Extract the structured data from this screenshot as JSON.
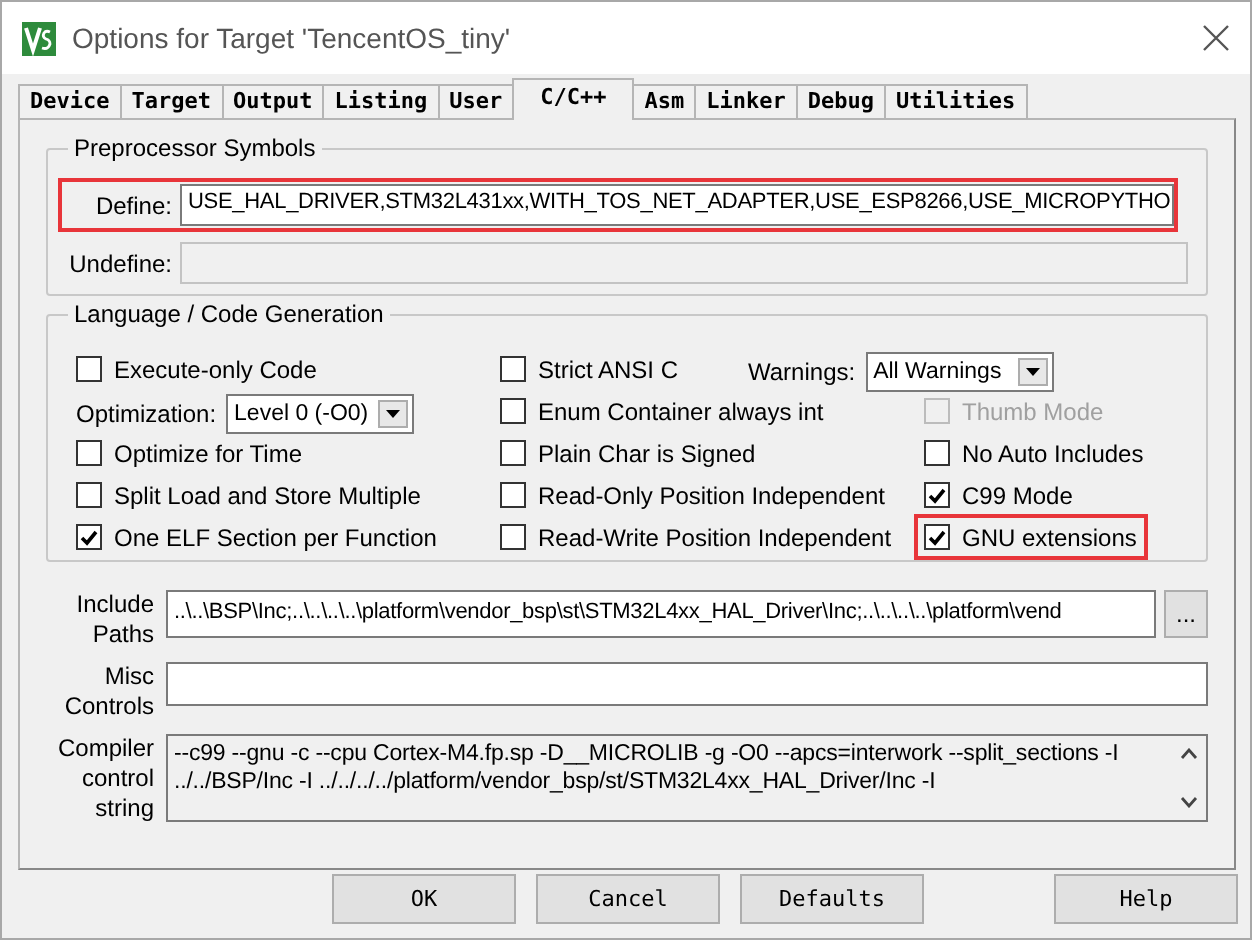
{
  "window": {
    "title": "Options for Target 'TencentOS_tiny'"
  },
  "tabs": [
    {
      "label": "Device",
      "selected": false
    },
    {
      "label": "Target",
      "selected": false
    },
    {
      "label": "Output",
      "selected": false
    },
    {
      "label": "Listing",
      "selected": false
    },
    {
      "label": "User",
      "selected": false
    },
    {
      "label": "C/C++",
      "selected": true
    },
    {
      "label": "Asm",
      "selected": false
    },
    {
      "label": "Linker",
      "selected": false
    },
    {
      "label": "Debug",
      "selected": false
    },
    {
      "label": "Utilities",
      "selected": false
    }
  ],
  "preprocessor": {
    "title": "Preprocessor Symbols",
    "define": {
      "label": "Define:",
      "value": "USE_HAL_DRIVER,STM32L431xx,WITH_TOS_NET_ADAPTER,USE_ESP8266,USE_MICROPYTHO",
      "highlighted": true,
      "disabled": false
    },
    "undefine": {
      "label": "Undefine:",
      "highlighted": false,
      "disabled": true
    }
  },
  "language": {
    "title": "Language / Code Generation",
    "columns": [
      [
        {
          "kind": "checkbox",
          "label": "Execute-only Code",
          "checked": false,
          "disabled": false,
          "highlighted": false
        },
        {
          "kind": "select",
          "label": "Optimization:",
          "value": "Level 0 (-O0)"
        },
        {
          "kind": "checkbox",
          "label": "Optimize for Time",
          "checked": false,
          "disabled": false,
          "highlighted": false
        },
        {
          "kind": "checkbox",
          "label": "Split Load and Store Multiple",
          "checked": false,
          "disabled": false,
          "highlighted": false
        },
        {
          "kind": "checkbox",
          "label": "One ELF Section per Function",
          "checked": true,
          "disabled": false,
          "highlighted": false
        }
      ],
      [
        {
          "kind": "checkbox",
          "label": "Strict ANSI C",
          "checked": false,
          "disabled": false,
          "highlighted": false
        },
        {
          "kind": "checkbox",
          "label": "Enum Container always int",
          "checked": false,
          "disabled": false,
          "highlighted": false
        },
        {
          "kind": "checkbox",
          "label": "Plain Char is Signed",
          "checked": false,
          "disabled": false,
          "highlighted": false
        },
        {
          "kind": "checkbox",
          "label": "Read-Only Position Independent",
          "checked": false,
          "disabled": false,
          "highlighted": false
        },
        {
          "kind": "checkbox",
          "label": "Read-Write Position Independent",
          "checked": false,
          "disabled": false,
          "highlighted": false
        }
      ],
      [
        {
          "kind": "select",
          "label": "Warnings:",
          "value": "All Warnings"
        },
        {
          "kind": "checkbox",
          "label": "Thumb Mode",
          "checked": false,
          "disabled": true,
          "highlighted": false
        },
        {
          "kind": "checkbox",
          "label": "No Auto Includes",
          "checked": false,
          "disabled": false,
          "highlighted": false
        },
        {
          "kind": "checkbox",
          "label": "C99 Mode",
          "checked": true,
          "disabled": false,
          "highlighted": false
        },
        {
          "kind": "checkbox",
          "label": "GNU extensions",
          "checked": true,
          "disabled": false,
          "highlighted": true
        }
      ]
    ]
  },
  "include_paths": {
    "label": "Include Paths",
    "value": "..\\..\\BSP\\Inc;..\\..\\..\\..\\platform\\vendor_bsp\\st\\STM32L4xx_HAL_Driver\\Inc;..\\..\\..\\..\\platform\\vend",
    "button": "..."
  },
  "misc_controls": {
    "label": "Misc Controls"
  },
  "compiler_string": {
    "label": "Compiler control string",
    "lines": [
      "--c99 --gnu -c --cpu Cortex-M4.fp.sp -D__MICROLIB -g -O0 --apcs=interwork --split_sections -I",
      "../../BSP/Inc -I ../../../../platform/vendor_bsp/st/STM32L4xx_HAL_Driver/Inc -I"
    ]
  },
  "buttons": [
    {
      "label": "OK",
      "kind": "main"
    },
    {
      "label": "Cancel",
      "kind": "main"
    },
    {
      "label": "Defaults",
      "kind": "main"
    },
    {
      "label": "Help",
      "kind": "aside"
    }
  ]
}
